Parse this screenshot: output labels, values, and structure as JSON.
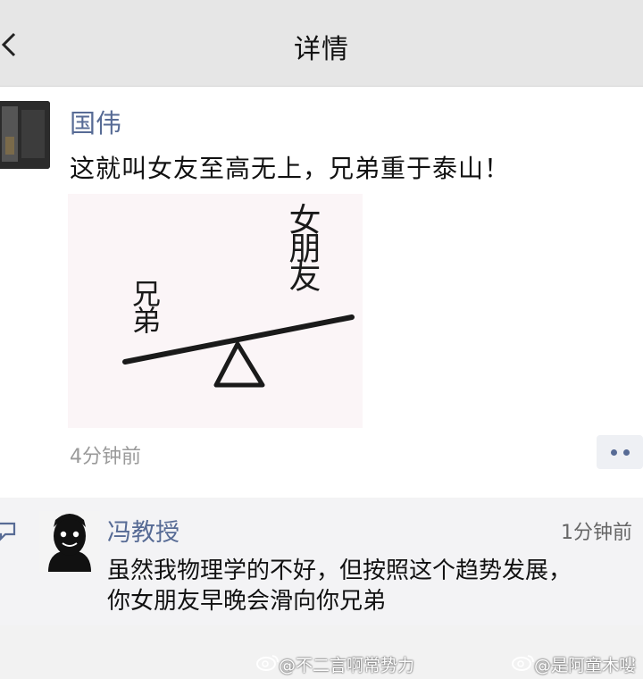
{
  "header": {
    "title": "详情",
    "back_icon": "chevron-left-icon"
  },
  "post": {
    "author": "国伟",
    "text": "这就叫女友至高无上，兄弟重于泰山！",
    "image_text_left": "兄弟",
    "image_text_right": "女朋友",
    "time": "4分钟前",
    "more_icon": "more-dots-icon"
  },
  "comment": {
    "icon": "comment-icon",
    "author": "冯教授",
    "time": "1分钟前",
    "text_line1": "虽然我物理学的不好，但按照这个趋势发展，",
    "text_line2": "你女朋友早晚会滑向你兄弟"
  },
  "watermarks": {
    "left": "@不二言啊常势力",
    "right": "@是阿童木嘍"
  },
  "colors": {
    "link": "#576b95",
    "nav_bg": "#e6e6e6"
  }
}
